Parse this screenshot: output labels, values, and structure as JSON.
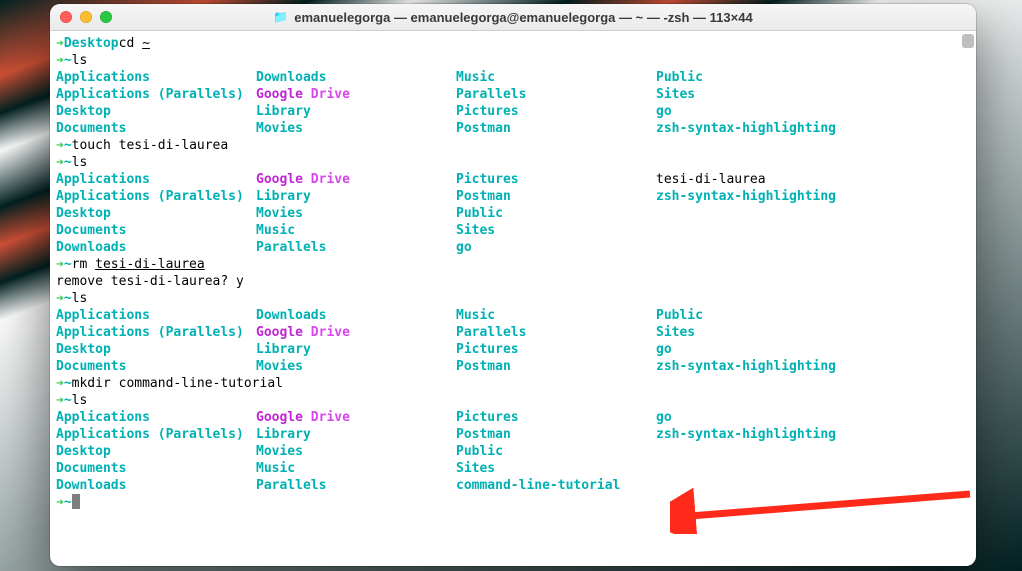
{
  "window": {
    "title": "emanuelegorga — emanuelegorga@emanuelegorga — ~ — -zsh — 113×44"
  },
  "styles": {
    "arrow_glyph": "➔"
  },
  "session": [
    {
      "type": "prompt",
      "cwd": "Desktop",
      "cmd_pre": "cd ",
      "cmd_udl": "~",
      "cmd_post": ""
    },
    {
      "type": "prompt",
      "cwd": "~",
      "cmd_pre": "ls",
      "cmd_udl": "",
      "cmd_post": ""
    },
    {
      "type": "ls",
      "rows": [
        [
          {
            "t": "Applications",
            "c": "dir"
          },
          {
            "t": "Downloads",
            "c": "dir"
          },
          {
            "t": "Music",
            "c": "dir"
          },
          {
            "t": "Public",
            "c": "dir"
          }
        ],
        [
          {
            "t": "Applications (Parallels)",
            "c": "dir"
          },
          {
            "t": "Google Drive",
            "c": "gd"
          },
          {
            "t": "Parallels",
            "c": "dir"
          },
          {
            "t": "Sites",
            "c": "dir"
          }
        ],
        [
          {
            "t": "Desktop",
            "c": "dir"
          },
          {
            "t": "Library",
            "c": "dir"
          },
          {
            "t": "Pictures",
            "c": "dir"
          },
          {
            "t": "go",
            "c": "dir"
          }
        ],
        [
          {
            "t": "Documents",
            "c": "dir"
          },
          {
            "t": "Movies",
            "c": "dir"
          },
          {
            "t": "Postman",
            "c": "dir"
          },
          {
            "t": "zsh-syntax-highlighting",
            "c": "dir"
          }
        ]
      ]
    },
    {
      "type": "prompt",
      "cwd": "~",
      "cmd_pre": "touch ",
      "cmd_udl": "",
      "cmd_post": "tesi-di-laurea"
    },
    {
      "type": "prompt",
      "cwd": "~",
      "cmd_pre": "ls",
      "cmd_udl": "",
      "cmd_post": ""
    },
    {
      "type": "ls",
      "rows": [
        [
          {
            "t": "Applications",
            "c": "dir"
          },
          {
            "t": "Google Drive",
            "c": "gd"
          },
          {
            "t": "Pictures",
            "c": "dir"
          },
          {
            "t": "tesi-di-laurea",
            "c": "plain"
          }
        ],
        [
          {
            "t": "Applications (Parallels)",
            "c": "dir"
          },
          {
            "t": "Library",
            "c": "dir"
          },
          {
            "t": "Postman",
            "c": "dir"
          },
          {
            "t": "zsh-syntax-highlighting",
            "c": "dir"
          }
        ],
        [
          {
            "t": "Desktop",
            "c": "dir"
          },
          {
            "t": "Movies",
            "c": "dir"
          },
          {
            "t": "Public",
            "c": "dir"
          },
          {
            "t": "",
            "c": "plain"
          }
        ],
        [
          {
            "t": "Documents",
            "c": "dir"
          },
          {
            "t": "Music",
            "c": "dir"
          },
          {
            "t": "Sites",
            "c": "dir"
          },
          {
            "t": "",
            "c": "plain"
          }
        ],
        [
          {
            "t": "Downloads",
            "c": "dir"
          },
          {
            "t": "Parallels",
            "c": "dir"
          },
          {
            "t": "go",
            "c": "dir"
          },
          {
            "t": "",
            "c": "plain"
          }
        ]
      ]
    },
    {
      "type": "prompt",
      "cwd": "~",
      "cmd_pre": "rm ",
      "cmd_udl": "tesi-di-laurea",
      "cmd_post": ""
    },
    {
      "type": "output",
      "text": "remove tesi-di-laurea? y"
    },
    {
      "type": "prompt",
      "cwd": "~",
      "cmd_pre": "ls",
      "cmd_udl": "",
      "cmd_post": ""
    },
    {
      "type": "ls",
      "rows": [
        [
          {
            "t": "Applications",
            "c": "dir"
          },
          {
            "t": "Downloads",
            "c": "dir"
          },
          {
            "t": "Music",
            "c": "dir"
          },
          {
            "t": "Public",
            "c": "dir"
          }
        ],
        [
          {
            "t": "Applications (Parallels)",
            "c": "dir"
          },
          {
            "t": "Google Drive",
            "c": "gd"
          },
          {
            "t": "Parallels",
            "c": "dir"
          },
          {
            "t": "Sites",
            "c": "dir"
          }
        ],
        [
          {
            "t": "Desktop",
            "c": "dir"
          },
          {
            "t": "Library",
            "c": "dir"
          },
          {
            "t": "Pictures",
            "c": "dir"
          },
          {
            "t": "go",
            "c": "dir"
          }
        ],
        [
          {
            "t": "Documents",
            "c": "dir"
          },
          {
            "t": "Movies",
            "c": "dir"
          },
          {
            "t": "Postman",
            "c": "dir"
          },
          {
            "t": "zsh-syntax-highlighting",
            "c": "dir"
          }
        ]
      ]
    },
    {
      "type": "prompt",
      "cwd": "~",
      "cmd_pre": "mkdir ",
      "cmd_udl": "",
      "cmd_post": "command-line-tutorial"
    },
    {
      "type": "prompt",
      "cwd": "~",
      "cmd_pre": "ls",
      "cmd_udl": "",
      "cmd_post": ""
    },
    {
      "type": "ls",
      "rows": [
        [
          {
            "t": "Applications",
            "c": "dir"
          },
          {
            "t": "Google Drive",
            "c": "gd"
          },
          {
            "t": "Pictures",
            "c": "dir"
          },
          {
            "t": "go",
            "c": "dir"
          }
        ],
        [
          {
            "t": "Applications (Parallels)",
            "c": "dir"
          },
          {
            "t": "Library",
            "c": "dir"
          },
          {
            "t": "Postman",
            "c": "dir"
          },
          {
            "t": "zsh-syntax-highlighting",
            "c": "dir"
          }
        ],
        [
          {
            "t": "Desktop",
            "c": "dir"
          },
          {
            "t": "Movies",
            "c": "dir"
          },
          {
            "t": "Public",
            "c": "dir"
          },
          {
            "t": "",
            "c": "plain"
          }
        ],
        [
          {
            "t": "Documents",
            "c": "dir"
          },
          {
            "t": "Music",
            "c": "dir"
          },
          {
            "t": "Sites",
            "c": "dir"
          },
          {
            "t": "",
            "c": "plain"
          }
        ],
        [
          {
            "t": "Downloads",
            "c": "dir"
          },
          {
            "t": "Parallels",
            "c": "dir"
          },
          {
            "t": "command-line-tutorial",
            "c": "dir"
          },
          {
            "t": "",
            "c": "plain"
          }
        ]
      ]
    },
    {
      "type": "prompt_cursor",
      "cwd": "~"
    }
  ],
  "annotation": {
    "arrow_color": "#ff2a1a"
  }
}
